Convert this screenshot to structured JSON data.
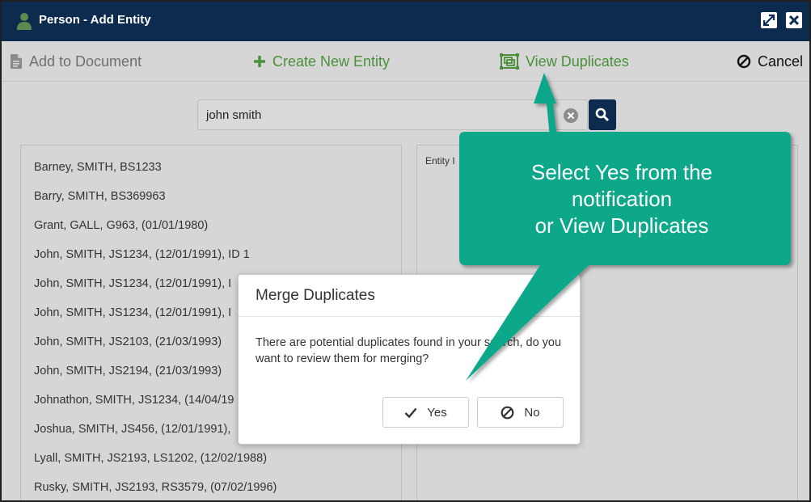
{
  "window": {
    "title": "Person - Add Entity"
  },
  "toolbar": {
    "add_to_document": "Add to Document",
    "create_new_entity": "Create New Entity",
    "view_duplicates": "View Duplicates",
    "cancel": "Cancel"
  },
  "search": {
    "value": "john smith"
  },
  "results": [
    "Barney, SMITH, BS1233",
    "Barry, SMITH, BS369963",
    "Grant, GALL, G963, (01/01/1980)",
    "John, SMITH, JS1234, (12/01/1991), ID 1",
    "John, SMITH, JS1234, (12/01/1991), I",
    "John, SMITH, JS1234, (12/01/1991), I",
    "John, SMITH, JS2103, (21/03/1993)",
    "John, SMITH, JS2194, (21/03/1993)",
    "Johnathon, SMITH, JS1234, (14/04/19",
    "Joshua, SMITH, JS456, (12/01/1991),",
    "Lyall, SMITH, JS2193, LS1202, (12/02/1988)",
    "Rusky, SMITH, JS2193, RS3579, (07/02/1996)"
  ],
  "entity_panel": {
    "label": "Entity I"
  },
  "modal": {
    "title": "Merge Duplicates",
    "message": "There are potential duplicates found in your search, do you want to review them for merging?",
    "yes_label": "Yes",
    "no_label": "No"
  },
  "callout": {
    "line1": "Select Yes from the",
    "line2": "notification",
    "line3": "or View Duplicates"
  },
  "colors": {
    "titlebar": "#0d2a4f",
    "accent_green": "#4a8f3a",
    "callout": "#0aa889"
  }
}
